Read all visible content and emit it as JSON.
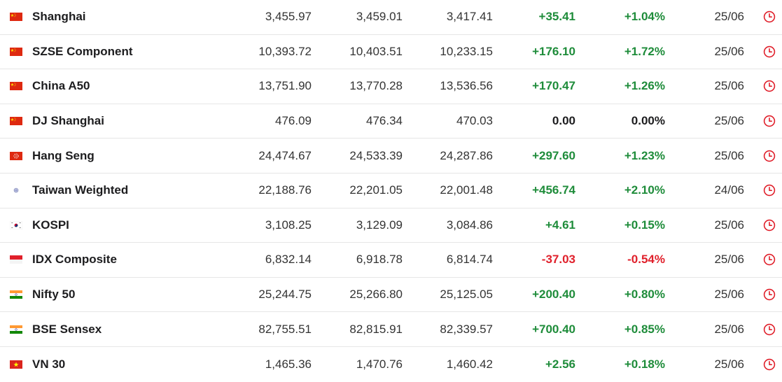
{
  "rows": [
    {
      "name": "Shanghai",
      "flag": "cn-flag-icon",
      "last": "3,455.97",
      "high": "3,459.01",
      "low": "3,417.41",
      "chg": "+35.41",
      "chg_pct": "+1.04%",
      "time": "25/06",
      "dir": "pos"
    },
    {
      "name": "SZSE Component",
      "flag": "cn-flag-icon",
      "last": "10,393.72",
      "high": "10,403.51",
      "low": "10,233.15",
      "chg": "+176.10",
      "chg_pct": "+1.72%",
      "time": "25/06",
      "dir": "pos"
    },
    {
      "name": "China A50",
      "flag": "cn-flag-icon",
      "last": "13,751.90",
      "high": "13,770.28",
      "low": "13,536.56",
      "chg": "+170.47",
      "chg_pct": "+1.26%",
      "time": "25/06",
      "dir": "pos"
    },
    {
      "name": "DJ Shanghai",
      "flag": "cn-flag-icon",
      "last": "476.09",
      "high": "476.34",
      "low": "470.03",
      "chg": "0.00",
      "chg_pct": "0.00%",
      "time": "25/06",
      "dir": "zero"
    },
    {
      "name": "Hang Seng",
      "flag": "hk-flag-icon",
      "last": "24,474.67",
      "high": "24,533.39",
      "low": "24,287.86",
      "chg": "+297.60",
      "chg_pct": "+1.23%",
      "time": "25/06",
      "dir": "pos"
    },
    {
      "name": "Taiwan Weighted",
      "flag": "tw-flag-icon",
      "last": "22,188.76",
      "high": "22,201.05",
      "low": "22,001.48",
      "chg": "+456.74",
      "chg_pct": "+2.10%",
      "time": "24/06",
      "dir": "pos"
    },
    {
      "name": "KOSPI",
      "flag": "kr-flag-icon",
      "last": "3,108.25",
      "high": "3,129.09",
      "low": "3,084.86",
      "chg": "+4.61",
      "chg_pct": "+0.15%",
      "time": "25/06",
      "dir": "pos"
    },
    {
      "name": "IDX Composite",
      "flag": "id-flag-icon",
      "last": "6,832.14",
      "high": "6,918.78",
      "low": "6,814.74",
      "chg": "-37.03",
      "chg_pct": "-0.54%",
      "time": "25/06",
      "dir": "neg"
    },
    {
      "name": "Nifty 50",
      "flag": "in-flag-icon",
      "last": "25,244.75",
      "high": "25,266.80",
      "low": "25,125.05",
      "chg": "+200.40",
      "chg_pct": "+0.80%",
      "time": "25/06",
      "dir": "pos"
    },
    {
      "name": "BSE Sensex",
      "flag": "in-flag-icon",
      "last": "82,755.51",
      "high": "82,815.91",
      "low": "82,339.57",
      "chg": "+700.40",
      "chg_pct": "+0.85%",
      "time": "25/06",
      "dir": "pos"
    },
    {
      "name": "VN 30",
      "flag": "vn-flag-icon",
      "last": "1,465.36",
      "high": "1,470.76",
      "low": "1,460.42",
      "chg": "+2.56",
      "chg_pct": "+0.18%",
      "time": "25/06",
      "dir": "pos"
    }
  ],
  "colors": {
    "positive": "#1e8c3a",
    "negative": "#e0202b",
    "clock": "#e0202b"
  },
  "icons": {
    "clock": "clock-icon"
  }
}
